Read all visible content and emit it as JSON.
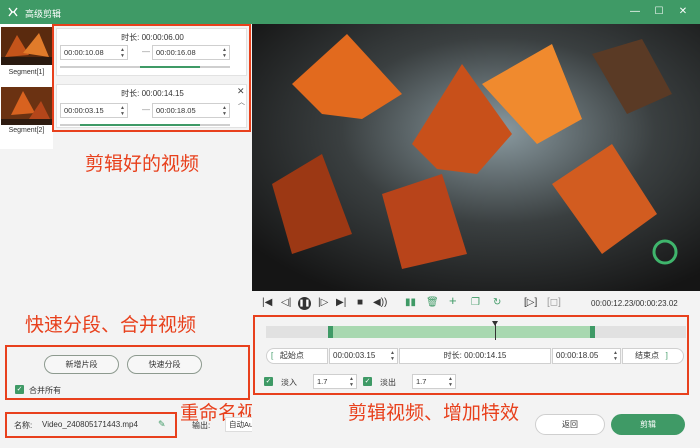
{
  "window": {
    "title": "高级剪辑",
    "min_icon": "minimize-icon",
    "max_icon": "maximize-icon",
    "close_icon": "close-icon"
  },
  "segments": [
    {
      "thumb_label": "Segment[1]",
      "duration_label": "时长:",
      "duration": "00:00:06.00",
      "start": "00:00:10.08",
      "end": "00:00:16.08"
    },
    {
      "thumb_label": "Segment[2]",
      "duration_label": "时长:",
      "duration": "00:00:14.15",
      "start": "00:00:03.15",
      "end": "00:00:18.05"
    }
  ],
  "annotations": {
    "clips": "剪辑好的视频",
    "split": "快速分段、合并视频",
    "rename": "重命名视频",
    "edit": "剪辑视频、增加特效"
  },
  "left_controls": {
    "add_segment": "新增片段",
    "quick_split": "快速分段",
    "merge_all": "合并所有",
    "merge_checked": true
  },
  "output": {
    "name_label": "名称:",
    "name_value": "Video_240805171443.mp4",
    "output_label": "输出:",
    "output_value": "自动Auto"
  },
  "player": {
    "time_display": "00:00:12.23/00:00:23.02"
  },
  "trim": {
    "start_label": "起始点",
    "start_value": "00:00:03.15",
    "duration_label": "时长:",
    "duration_value": "00:00:14.15",
    "end_value": "00:00:18.05",
    "end_label": "结束点"
  },
  "fade": {
    "fade_in_label": "淡入",
    "fade_in_value": "1.7",
    "fade_out_label": "淡出",
    "fade_out_value": "1.7",
    "fade_in_checked": true,
    "fade_out_checked": true
  },
  "actions": {
    "back": "返回",
    "cut": "剪辑"
  },
  "colors": {
    "accent": "#3f9a66",
    "annotation": "#e8401c"
  }
}
